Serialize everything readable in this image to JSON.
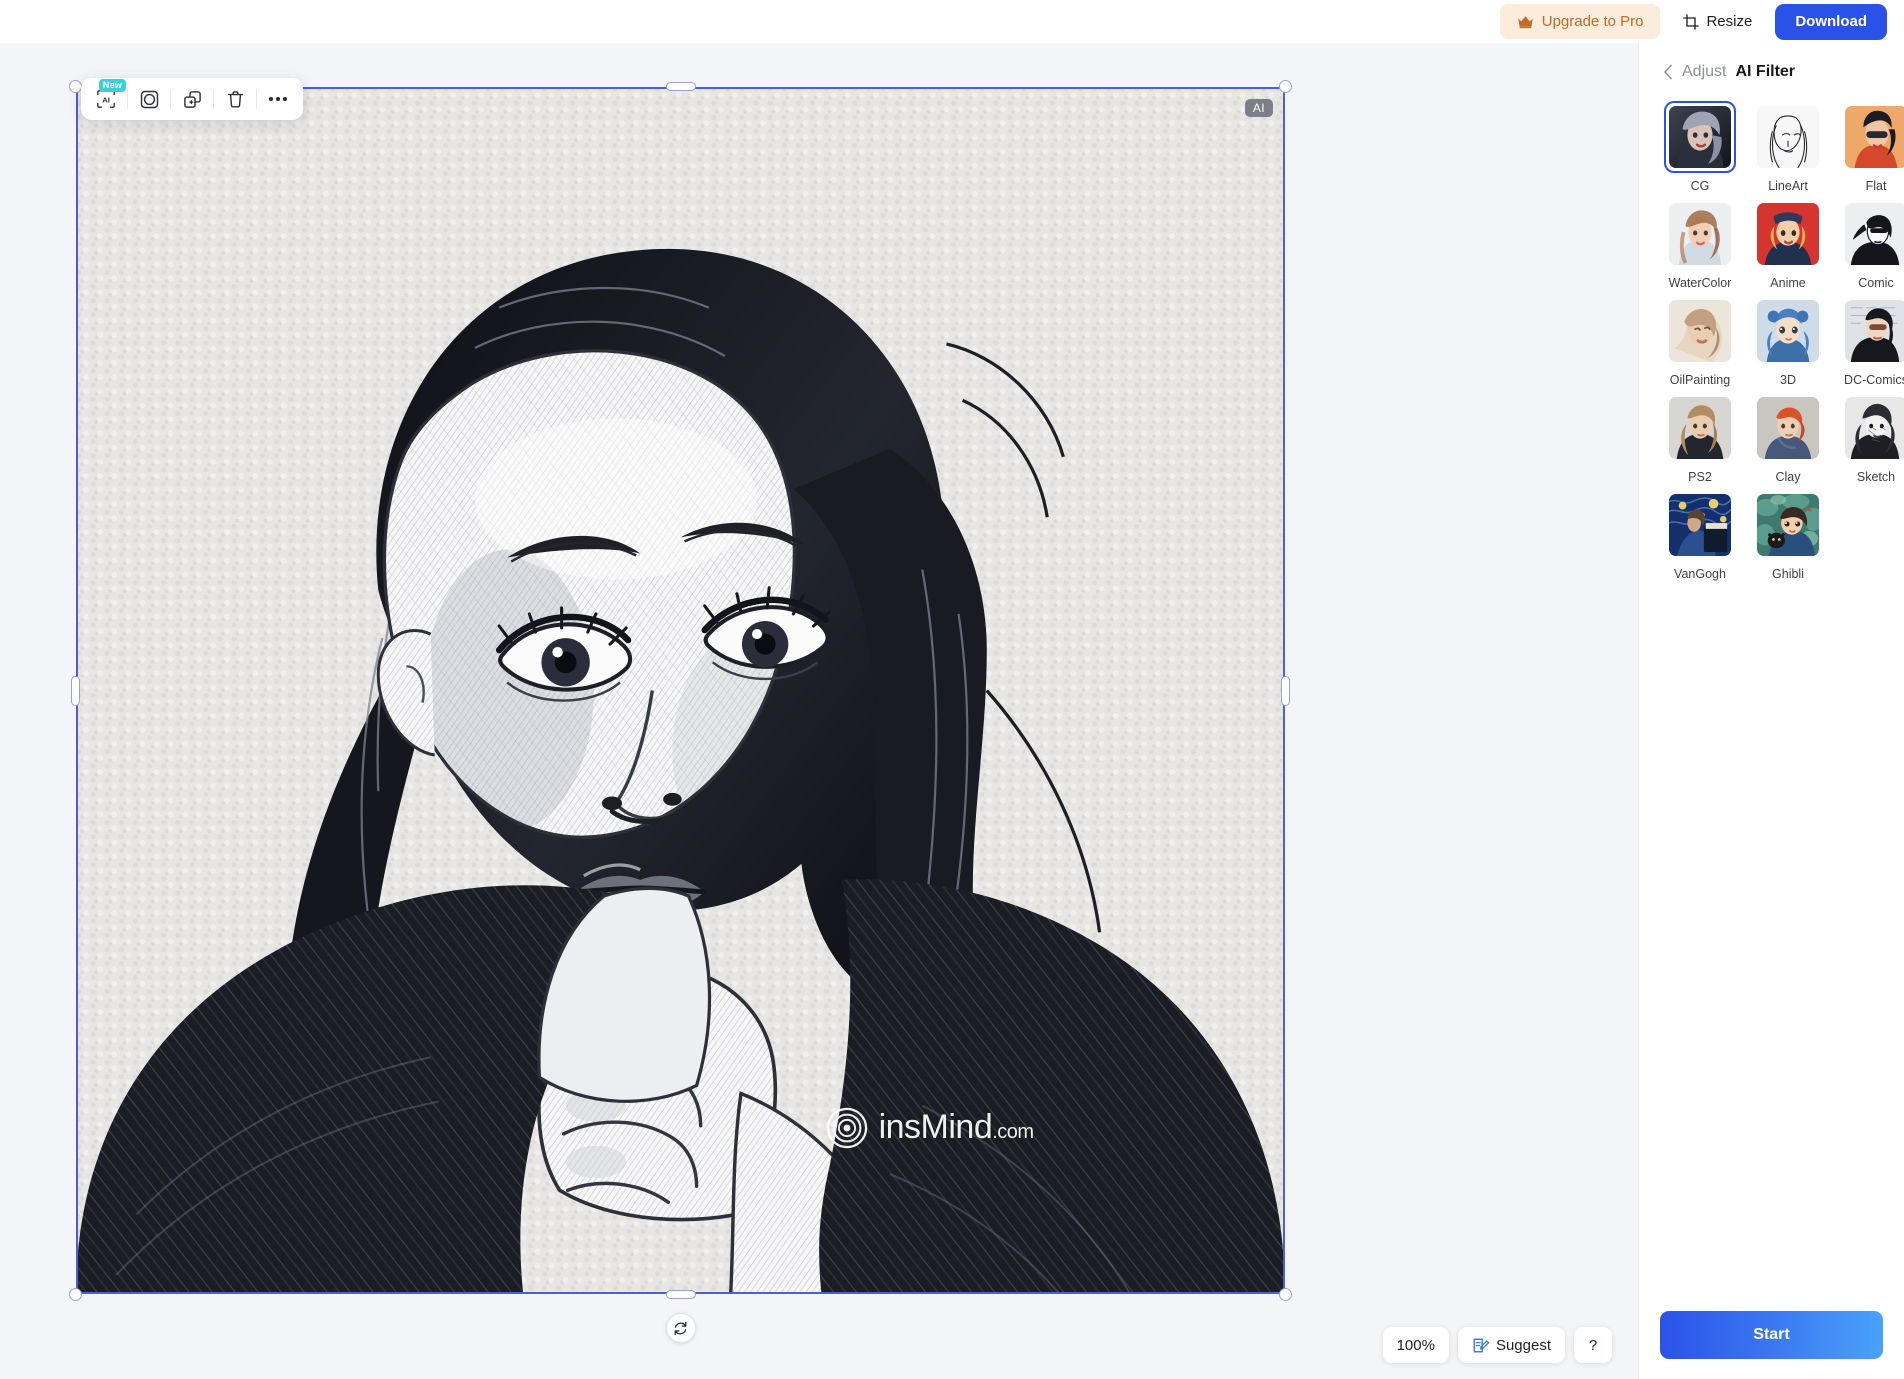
{
  "topbar": {
    "upgrade_label": "Upgrade to Pro",
    "upgrade_icon": "crown-icon",
    "resize_label": "Resize",
    "resize_icon": "crop-resize-icon",
    "download_label": "Download",
    "accent_blue": "#2b52e8",
    "upgrade_bg": "#fcecdb",
    "upgrade_fg": "#c2692c"
  },
  "canvas": {
    "background": "#f3f5f8",
    "selection_color": "#4a5fd9",
    "ai_badge": "AI",
    "watermark_text": "insMind",
    "watermark_suffix": ".com",
    "watermark_logo": "concentric-circles-logo"
  },
  "floating_toolbar": {
    "items": [
      {
        "name": "ai-enhance-icon",
        "badge": "New"
      },
      {
        "name": "mask-circle-icon",
        "badge": ""
      },
      {
        "name": "duplicate-icon",
        "badge": ""
      },
      {
        "name": "delete-icon",
        "badge": ""
      },
      {
        "name": "more-options-icon",
        "badge": ""
      }
    ],
    "badge_color": "#3ecfd8"
  },
  "status_bar": {
    "zoom_level": "100%",
    "suggest_label": "Suggest",
    "suggest_icon": "edit-document-icon",
    "help_label": "?"
  },
  "sidebar": {
    "back_icon": "chevron-left-icon",
    "parent_label": "Adjust",
    "title": "AI Filter",
    "start_label": "Start",
    "filters": [
      {
        "label": "CG",
        "selected": true
      },
      {
        "label": "LineArt",
        "selected": false
      },
      {
        "label": "Flat",
        "selected": false
      },
      {
        "label": "WaterColor",
        "selected": false
      },
      {
        "label": "Anime",
        "selected": false
      },
      {
        "label": "Comic",
        "selected": false
      },
      {
        "label": "OilPainting",
        "selected": false
      },
      {
        "label": "3D",
        "selected": false
      },
      {
        "label": "DC-Comics",
        "selected": false
      },
      {
        "label": "PS2",
        "selected": false
      },
      {
        "label": "Clay",
        "selected": false
      },
      {
        "label": "Sketch",
        "selected": false
      },
      {
        "label": "VanGogh",
        "selected": false
      },
      {
        "label": "Ghibli",
        "selected": false
      }
    ]
  }
}
